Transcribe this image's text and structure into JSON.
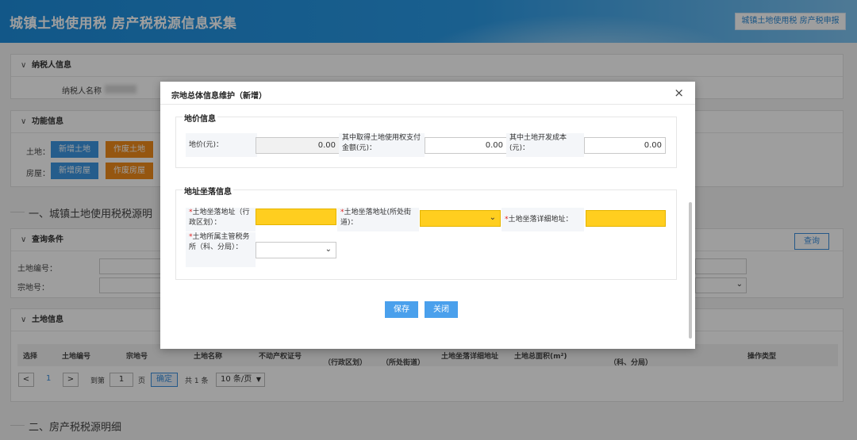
{
  "header": {
    "title": "城镇土地使用税 房产税税源信息采集",
    "switch_label": "城镇土地使用税 房产税申报"
  },
  "taxpayer": {
    "head": "纳税人信息",
    "name_label": "纳税人名称"
  },
  "function": {
    "head": "功能信息",
    "land_label": "土地：",
    "house_label": "房屋：",
    "add_land": "新增土地",
    "void_land": "作废土地",
    "add_house": "新增房屋",
    "void_house": "作废房屋"
  },
  "section1": {
    "title": "一、城镇土地使用税税源明"
  },
  "query": {
    "head": "查询条件",
    "land_no_label": "土地编号：",
    "parcel_no_label": "宗地号：",
    "query_button": "查询"
  },
  "land_info": {
    "head": "土地信息",
    "columns": [
      "选择",
      "土地编号",
      "宗地号",
      "土地名称",
      "不动产权证号",
      "（行政区划）",
      "（所处街道）",
      "土地坐落详细地址",
      "土地总面积(m²)",
      "（科、分局）",
      "操作类型"
    ]
  },
  "pager": {
    "prev": "<",
    "current_page": "1",
    "next": ">",
    "goto_label": "到第",
    "page_input": "1",
    "page_unit": "页",
    "confirm": "确定",
    "total": "共 1 条",
    "page_size": "10 条/页"
  },
  "section2": {
    "title": "二、房产税税源明细"
  },
  "modal": {
    "title": "宗地总体信息维护（新增）",
    "close": "×",
    "price_section": {
      "legend": "地价信息",
      "price_label": "地价(元)：",
      "price_value": "0.00",
      "acq_label": "其中取得土地使用权支付金额(元)：",
      "acq_value": "0.00",
      "dev_label": "其中土地开发成本(元)：",
      "dev_value": "0.00"
    },
    "address_section": {
      "legend": "地址坐落信息",
      "required_mark": "*",
      "addr_label": "土地坐落地址（行政区划）：",
      "street_label": "土地坐落地址(所处街道)：",
      "detail_label": "土地坐落详细地址：",
      "authority_label": "土地所属主管税务所（科、分局）："
    },
    "save": "保存",
    "close_button": "关闭"
  },
  "icons": {
    "collapse": "chevron-down-icon",
    "dropdown": "chevron-down-icon"
  }
}
